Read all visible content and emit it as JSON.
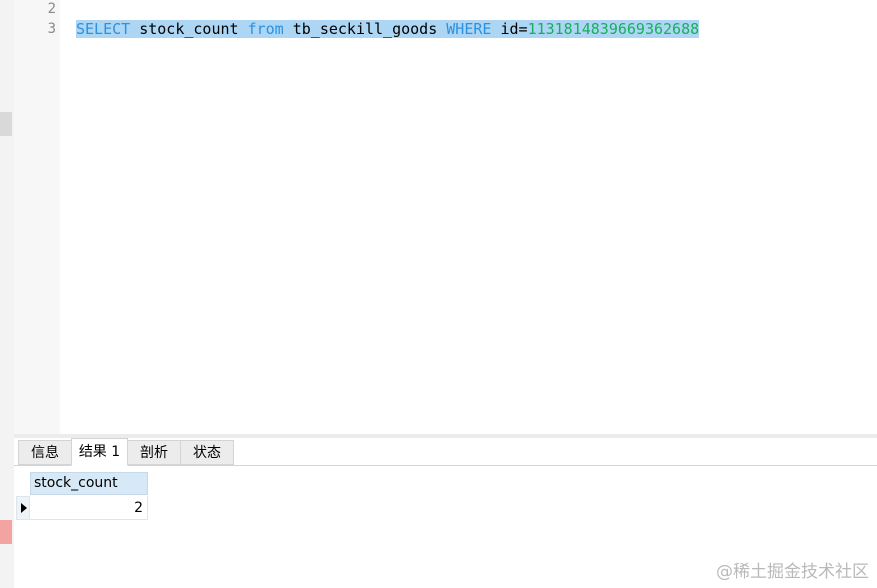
{
  "editor": {
    "line_numbers": [
      "2",
      "3"
    ],
    "query": {
      "kw_select": "SELECT",
      "t1": " stock_count ",
      "kw_from": "from",
      "t2": " tb_seckill_goods ",
      "kw_where": "WHERE",
      "t3": " id=",
      "id_value": "1131814839669362688"
    }
  },
  "tabs": [
    {
      "label": "信息"
    },
    {
      "label": "结果 1"
    },
    {
      "label": "剖析"
    },
    {
      "label": "状态"
    }
  ],
  "active_tab": "结果 1",
  "result": {
    "columns": [
      "stock_count"
    ],
    "rows": [
      [
        "2"
      ]
    ]
  },
  "watermark": "@稀土掘金技术社区",
  "colors": {
    "selection": "#add6f5",
    "keyword": "#2b91e0",
    "number": "#17b05a",
    "header_bg": "#d7e9f7"
  }
}
